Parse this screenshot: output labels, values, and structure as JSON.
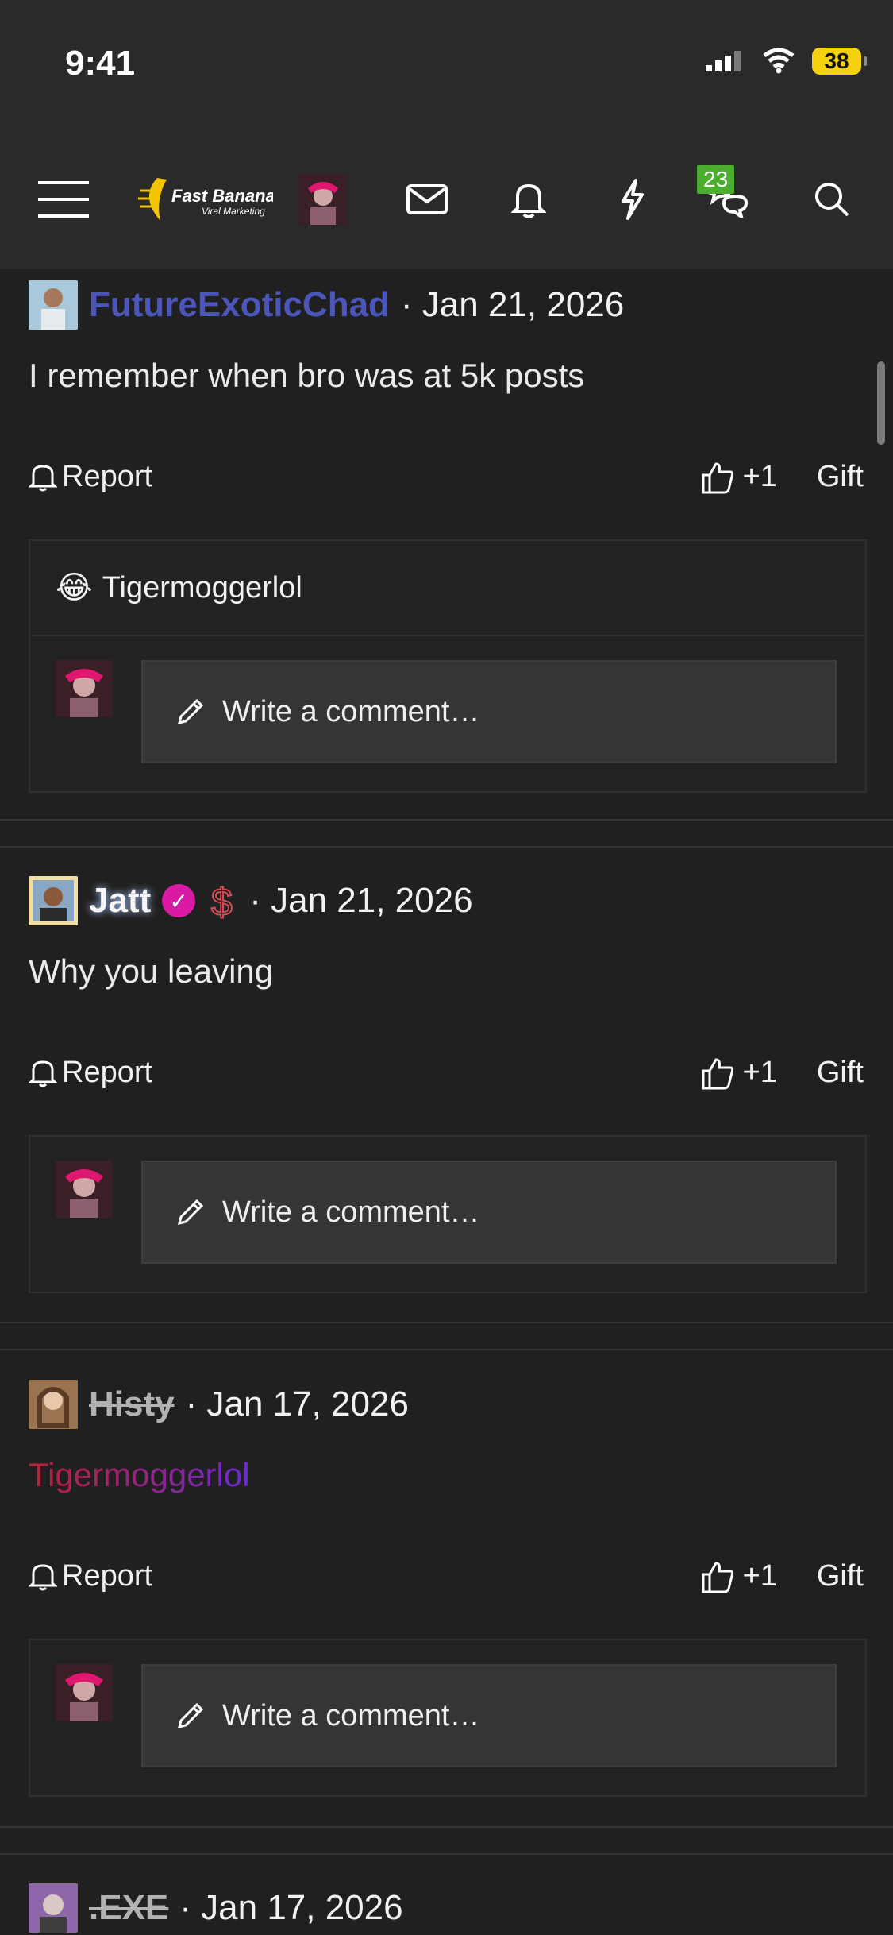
{
  "status": {
    "time": "9:41",
    "battery": "38"
  },
  "nav": {
    "logo_text": "Fast Banana",
    "logo_sub": "Viral Marketing",
    "chat_badge": "23"
  },
  "posts": [
    {
      "author": "FutureExoticChad",
      "date": "· Jan 21, 2026",
      "text": "I remember when bro was at 5k posts",
      "report": "Report",
      "like": "+1",
      "gift": "Gift",
      "reply_user": "Tigermoggerlol",
      "write_placeholder": "Write a comment…"
    },
    {
      "author": "Jatt",
      "date": "· Jan 21, 2026",
      "text": "Why you leaving",
      "report": "Report",
      "like": "+1",
      "gift": "Gift",
      "write_placeholder": "Write a comment…"
    },
    {
      "author": "Histy",
      "date": "· Jan 17, 2026",
      "text": "Tigermoggerlol",
      "report": "Report",
      "like": "+1",
      "gift": "Gift",
      "write_placeholder": "Write a comment…"
    },
    {
      "author": ".EXE",
      "date": "· Jan 17, 2026"
    }
  ]
}
